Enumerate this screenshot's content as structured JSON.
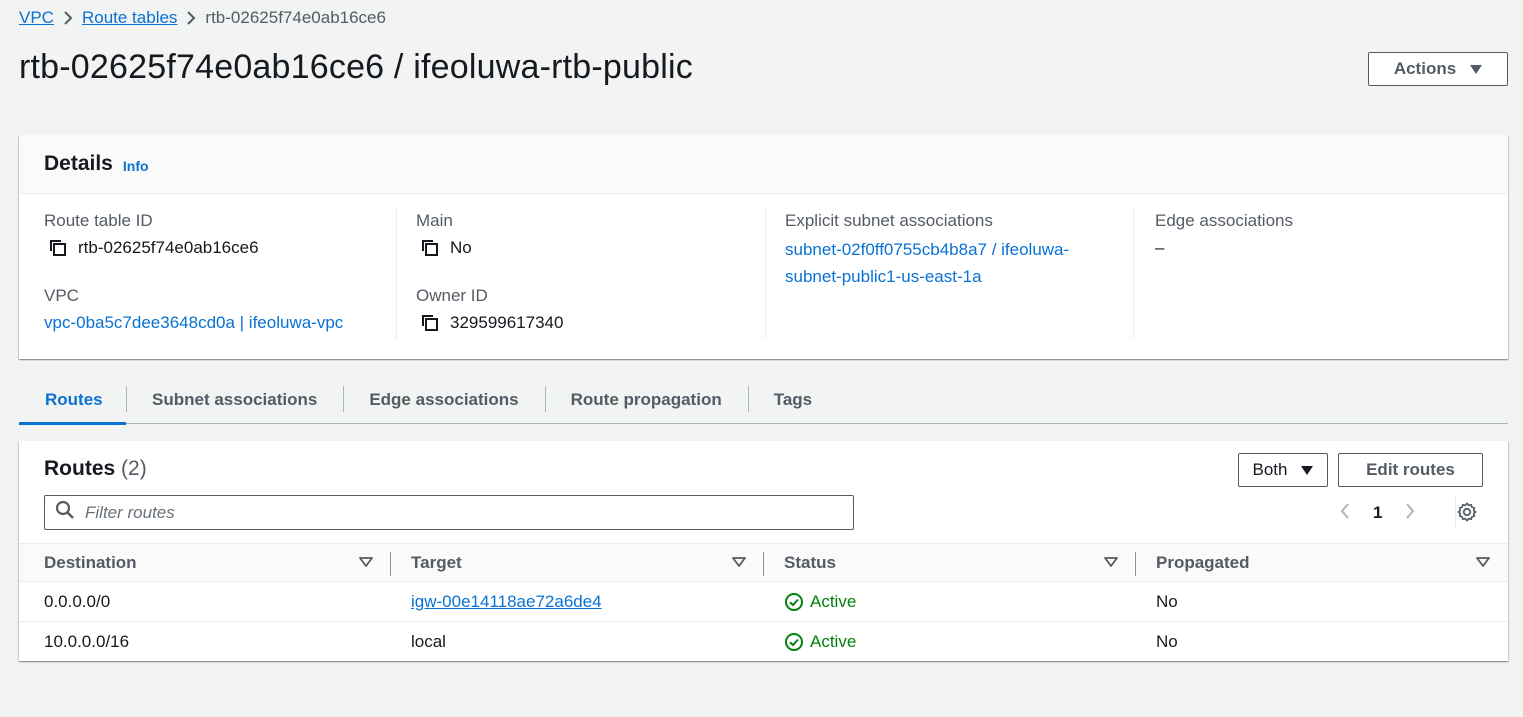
{
  "breadcrumb": {
    "items": [
      "VPC",
      "Route tables"
    ],
    "current": "rtb-02625f74e0ab16ce6"
  },
  "header": {
    "title": "rtb-02625f74e0ab16ce6 / ifeoluwa-rtb-public",
    "actions_label": "Actions"
  },
  "details": {
    "heading": "Details",
    "info": "Info",
    "route_table_id": {
      "label": "Route table ID",
      "value": "rtb-02625f74e0ab16ce6"
    },
    "vpc": {
      "label": "VPC",
      "value": "vpc-0ba5c7dee3648cd0a | ifeoluwa-vpc"
    },
    "main": {
      "label": "Main",
      "value": "No"
    },
    "owner_id": {
      "label": "Owner ID",
      "value": "329599617340"
    },
    "explicit_subnet": {
      "label": "Explicit subnet associations",
      "value": "subnet-02f0ff0755cb4b8a7 / ifeoluwa-subnet-public1-us-east-1a"
    },
    "edge": {
      "label": "Edge associations",
      "value": "–"
    }
  },
  "tabs": [
    {
      "label": "Routes",
      "active": true
    },
    {
      "label": "Subnet associations",
      "active": false
    },
    {
      "label": "Edge associations",
      "active": false
    },
    {
      "label": "Route propagation",
      "active": false
    },
    {
      "label": "Tags",
      "active": false
    }
  ],
  "routes": {
    "title": "Routes",
    "count": "(2)",
    "filter_select": "Both",
    "edit_label": "Edit routes",
    "filter_placeholder": "Filter routes",
    "page": "1",
    "columns": [
      "Destination",
      "Target",
      "Status",
      "Propagated"
    ],
    "rows": [
      {
        "destination": "0.0.0.0/0",
        "target": "igw-00e14118ae72a6de4",
        "target_is_link": true,
        "status": "Active",
        "propagated": "No"
      },
      {
        "destination": "10.0.0.0/16",
        "target": "local",
        "target_is_link": false,
        "status": "Active",
        "propagated": "No"
      }
    ]
  },
  "colors": {
    "link": "#0972d3",
    "success": "#037f0c",
    "background": "#f2f3f3"
  },
  "icons": [
    "chevron-right-icon",
    "copy-icon",
    "caret-down-icon",
    "search-icon",
    "chevron-left-icon",
    "gear-icon",
    "sort-icon",
    "check-circle-icon"
  ]
}
